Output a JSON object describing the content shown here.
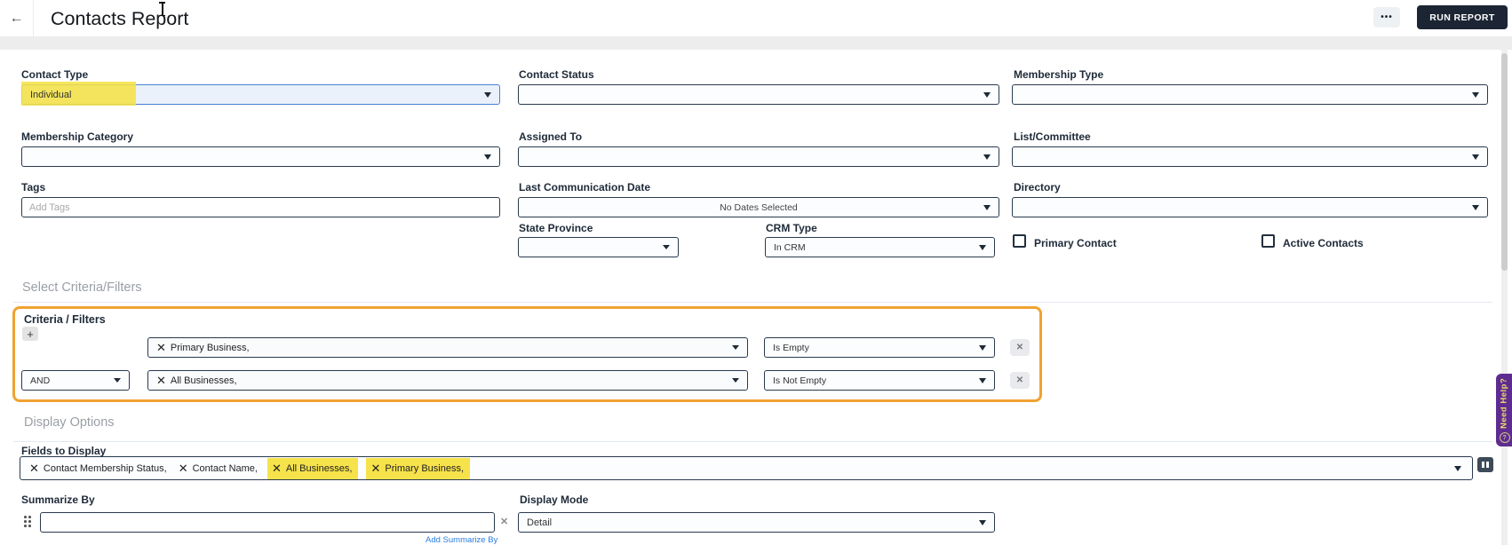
{
  "header": {
    "back_icon": "←",
    "title": "Contacts Report",
    "more_label": "•••",
    "run_report_label": "RUN REPORT"
  },
  "filters": {
    "contact_type": {
      "label": "Contact Type",
      "value": "Individual",
      "highlighted": true
    },
    "contact_status": {
      "label": "Contact Status",
      "value": ""
    },
    "membership_type": {
      "label": "Membership Type",
      "value": ""
    },
    "membership_category": {
      "label": "Membership Category",
      "value": ""
    },
    "assigned_to": {
      "label": "Assigned To",
      "value": ""
    },
    "list_committee": {
      "label": "List/Committee",
      "value": ""
    },
    "tags": {
      "label": "Tags",
      "placeholder": "Add Tags",
      "value": ""
    },
    "last_communication_date": {
      "label": "Last Communication Date",
      "value": "No Dates Selected"
    },
    "directory": {
      "label": "Directory",
      "value": ""
    },
    "state_province": {
      "label": "State Province",
      "value": ""
    },
    "crm_type": {
      "label": "CRM Type",
      "value": "In CRM"
    },
    "primary_contact": {
      "label": "Primary Contact",
      "checked": false
    },
    "active_contacts": {
      "label": "Active Contacts",
      "checked": false
    }
  },
  "criteria": {
    "section_title": "Select Criteria/Filters",
    "box_title": "Criteria / Filters",
    "add_button_label": "+",
    "remove_button_label": "✕",
    "rows": [
      {
        "conjunction": "",
        "field_chip": "Primary Business,",
        "operator": "Is Empty"
      },
      {
        "conjunction": "AND",
        "field_chip": "All Businesses,",
        "operator": "Is Not Empty"
      }
    ]
  },
  "display_options": {
    "section_title": "Display Options",
    "fields_to_display": {
      "label": "Fields to Display",
      "chips": [
        {
          "text": "Contact Membership Status,",
          "highlighted": false
        },
        {
          "text": "Contact Name,",
          "highlighted": false
        },
        {
          "text": "All Businesses,",
          "highlighted": true
        },
        {
          "text": "Primary Business,",
          "highlighted": true
        }
      ]
    },
    "summarize_by": {
      "label": "Summarize By",
      "value": "",
      "clear_label": "✕",
      "add_link": "Add Summarize By"
    },
    "display_mode": {
      "label": "Display Mode",
      "value": "Detail"
    }
  },
  "help_tab": {
    "label": "Need Help?",
    "icon": "?"
  },
  "icons": {
    "chip_remove": "✕"
  },
  "colors": {
    "highlight_yellow": "#f6e241",
    "accent_orange": "#f0a231",
    "run_button_dark": "#1c2533",
    "help_purple": "#5e2c90",
    "help_text_yellow": "#e8dc6a",
    "link_blue": "#2a7de1"
  }
}
